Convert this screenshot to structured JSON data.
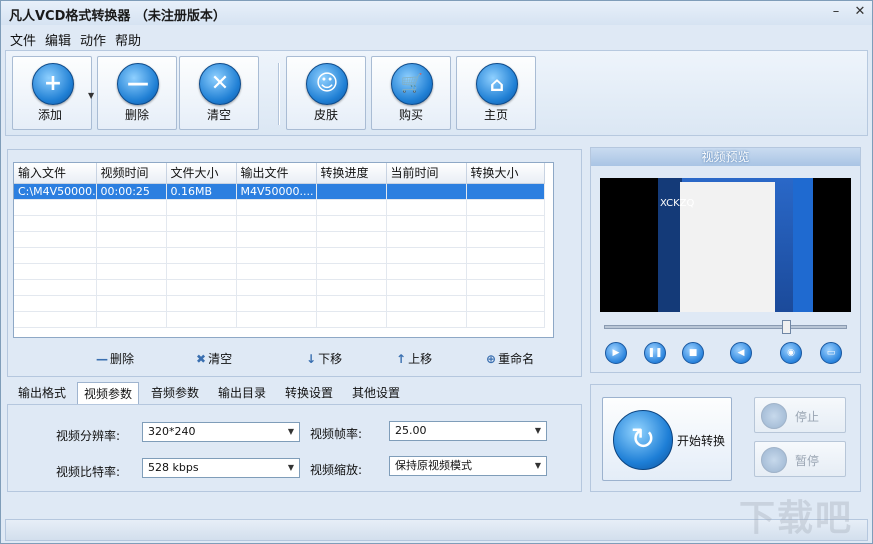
{
  "window": {
    "title": "凡人VCD格式转换器 （未注册版本）",
    "minimize": "–",
    "close": "✕"
  },
  "menu": [
    "文件",
    "编辑",
    "动作",
    "帮助"
  ],
  "toolbar": {
    "add": "添加",
    "delete": "删除",
    "clear": "清空",
    "skin": "皮肤",
    "buy": "购买",
    "home": "主页"
  },
  "table": {
    "headers": [
      "输入文件",
      "视频时间",
      "文件大小",
      "输出文件",
      "转换进度",
      "当前时间",
      "转换大小"
    ],
    "rows": [
      [
        "C:\\M4V50000...",
        "00:00:25",
        "0.16MB",
        "M4V50000....",
        "",
        "",
        ""
      ]
    ]
  },
  "list_actions": {
    "delete": "删除",
    "clear": "清空",
    "down": "下移",
    "up": "上移",
    "rename": "重命名"
  },
  "preview": {
    "title": "视频预览",
    "screen_text": "XCKZQ"
  },
  "tabs": [
    "输出格式",
    "视频参数",
    "音频参数",
    "输出目录",
    "转换设置",
    "其他设置"
  ],
  "params": {
    "resolution_label": "视频分辨率:",
    "resolution_value": "320*240",
    "framerate_label": "视频帧率:",
    "framerate_value": "25.00",
    "bitrate_label": "视频比特率:",
    "bitrate_value": "528 kbps",
    "scale_label": "视频缩放:",
    "scale_value": "保持原视频模式"
  },
  "convert": {
    "start": "开始转换",
    "stop": "停止",
    "pause": "暂停"
  },
  "watermark": "下载吧"
}
